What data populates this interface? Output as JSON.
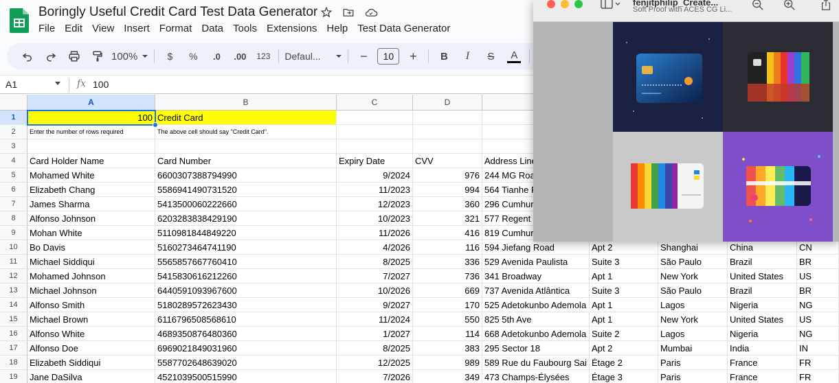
{
  "app": {
    "title": "Boringly Useful Credit Card Test Data Generator",
    "menu": [
      "File",
      "Edit",
      "View",
      "Insert",
      "Format",
      "Data",
      "Tools",
      "Extensions",
      "Help",
      "Test Data Generator"
    ]
  },
  "toolbar": {
    "zoom": "100%",
    "currency": "$",
    "percent": "%",
    "decrease_decimal": ".0",
    "increase_decimal": ".00",
    "number_format": "123",
    "font": "Defaul...",
    "font_size": "10",
    "minus": "−",
    "plus": "+",
    "bold": "B",
    "italic": "I",
    "strike": "S",
    "text_color": "A"
  },
  "formula_bar": {
    "cell_ref": "A1",
    "fx": "fx",
    "value": "100"
  },
  "columns": [
    "A",
    "B",
    "C",
    "D"
  ],
  "rows": [
    {
      "n": "1",
      "a": "100",
      "b": "Credit Card",
      "c": "",
      "d": "",
      "e": ""
    },
    {
      "n": "2",
      "a": "Enter the number of rows required",
      "b": "The above cell should say \"Credit Card\".",
      "c": "",
      "d": "",
      "e": ""
    },
    {
      "n": "3",
      "a": "",
      "b": "",
      "c": "",
      "d": "",
      "e": ""
    },
    {
      "n": "4",
      "a": "Card Holder Name",
      "b": "Card Number",
      "c": "Expiry Date",
      "d": "CVV",
      "e": "Address Line"
    },
    {
      "n": "5",
      "a": "Mohamed White",
      "b": "6600307388794990",
      "c": "9/2024",
      "d": "976",
      "e": "244 MG Roa"
    },
    {
      "n": "6",
      "a": "Elizabeth Chang",
      "b": "5586941490731520",
      "c": "11/2023",
      "d": "994",
      "e": "564 Tianhe R"
    },
    {
      "n": "7",
      "a": "James Sharma",
      "b": "5413500060222660",
      "c": "12/2023",
      "d": "360",
      "e": "296 Cumhur"
    },
    {
      "n": "8",
      "a": "Alfonso Johnson",
      "b": "6203283838429190",
      "c": "10/2023",
      "d": "321",
      "e": "577 Regent"
    },
    {
      "n": "9",
      "a": "Mohan White",
      "b": "5110981844849220",
      "c": "11/2026",
      "d": "416",
      "e": "819 Cumhur"
    },
    {
      "n": "10",
      "a": "Bo Davis",
      "b": "5160273464741190",
      "c": "4/2026",
      "d": "116",
      "e": "594 Jiefang Road",
      "f": "Apt 2",
      "g": "Shanghai",
      "h": "China",
      "i": "CN"
    },
    {
      "n": "11",
      "a": "Michael Siddiqui",
      "b": "5565857667760410",
      "c": "8/2025",
      "d": "336",
      "e": "529 Avenida Paulista",
      "f": "Suite 3",
      "g": "São Paulo",
      "h": "Brazil",
      "i": "BR"
    },
    {
      "n": "12",
      "a": "Mohamed Johnson",
      "b": "5415830616212260",
      "c": "7/2027",
      "d": "736",
      "e": "341 Broadway",
      "f": "Apt 1",
      "g": "New York",
      "h": "United States",
      "i": "US"
    },
    {
      "n": "13",
      "a": "Michael Johnson",
      "b": "6440591093967600",
      "c": "10/2026",
      "d": "669",
      "e": "737 Avenida Atlântica",
      "f": "Suite 3",
      "g": "São Paulo",
      "h": "Brazil",
      "i": "BR"
    },
    {
      "n": "14",
      "a": "Alfonso Smith",
      "b": "5180289572623430",
      "c": "9/2027",
      "d": "170",
      "e": "525 Adetokunbo Ademola",
      "f": "Apt 1",
      "g": "Lagos",
      "h": "Nigeria",
      "i": "NG"
    },
    {
      "n": "15",
      "a": "Michael Brown",
      "b": "6116796508568610",
      "c": "11/2024",
      "d": "550",
      "e": "825 5th Ave",
      "f": "Apt 1",
      "g": "New York",
      "h": "United States",
      "i": "US"
    },
    {
      "n": "16",
      "a": "Alfonso White",
      "b": "4689350876480360",
      "c": "1/2027",
      "d": "114",
      "e": "668 Adetokunbo Ademola",
      "f": "Suite 2",
      "g": "Lagos",
      "h": "Nigeria",
      "i": "NG"
    },
    {
      "n": "17",
      "a": "Alfonso Doe",
      "b": "6969021849031960",
      "c": "8/2025",
      "d": "383",
      "e": "295 Sector 18",
      "f": "Apt 2",
      "g": "Mumbai",
      "h": "India",
      "i": "IN"
    },
    {
      "n": "18",
      "a": "Elizabeth Siddiqui",
      "b": "5587702648639020",
      "c": "12/2025",
      "d": "989",
      "e": "589 Rue du Faubourg Sai",
      "f": "Étage 2",
      "g": "Paris",
      "h": "France",
      "i": "FR"
    },
    {
      "n": "19",
      "a": "Jane DaSilva",
      "b": "4521039500515990",
      "c": "7/2026",
      "d": "349",
      "e": "473 Champs-Élysées",
      "f": "Étage 3",
      "g": "Paris",
      "h": "France",
      "i": "FR"
    }
  ],
  "preview_window": {
    "title": "fenjitphilip_Create...",
    "subtitle": "Soft Proof with ACES CG Li..."
  },
  "colors": {
    "yellow_highlight": "#ffff00",
    "selection_blue": "#1a73e8",
    "sheets_green": "#0f9d58"
  }
}
